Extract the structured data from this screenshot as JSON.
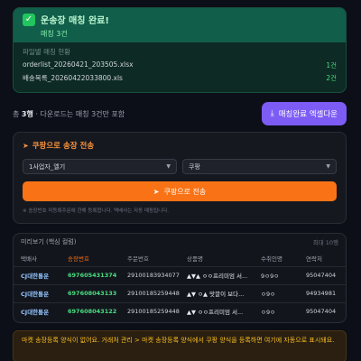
{
  "success": {
    "title": "운송장 매칭 완료!",
    "subtitle": "매칭 3건",
    "files_heading": "파일별 매칭 현황",
    "files": [
      {
        "name": "orderlist_20260421_203505.xlsx",
        "count": "1건"
      },
      {
        "name": "배송목록_20260422033800.xls",
        "count": "2건"
      }
    ]
  },
  "summary": {
    "prefix": "총",
    "total": "3행",
    "detail": "· 다운로드는 매칭 3건만 포함"
  },
  "actions": {
    "excel_download": "매칭완료 엑셀다운"
  },
  "coupang": {
    "title": "쿠팡으로 송장 전송",
    "vendor_select": "1사업자_엘기",
    "courier_select": "쿠팡",
    "send_button": "쿠팡으로 전송",
    "hint": "※ 송장번호 미등록주문에 한해 등록합니다. 택배사는 자동 매핑됩니다."
  },
  "preview": {
    "title": "미리보기 (핵심 컬럼)",
    "max_rows": "최대 10행",
    "columns": [
      "택배사",
      "송장번호",
      "주문번호",
      "상품명",
      "수취인명",
      "연락처"
    ],
    "rows": [
      [
        "CJ대한통운",
        "697605431374",
        "29100183934077",
        "▲▼▲ ㅇㅇ프리미엄 서...",
        "9ㅇ9ㅇ",
        "95047404"
      ],
      [
        "CJ대한통운",
        "697608043133",
        "29100185259448",
        "▲▼ ㅇ▲ 맛깔이 보다...",
        "ㅇ9ㅇ",
        "94934981"
      ],
      [
        "CJ대한통운",
        "697608043122",
        "29100185259448",
        "▲▼ ㅇㅇ프리미엄 서...",
        "ㅇ9ㅇ",
        "95047404"
      ]
    ]
  },
  "warning": {
    "text": "마켓 송장등록 양식이 없어요. 거래처 관리 > 마켓 송장등록 양식에서 쿠팡 양식을 등록하면 여기에 자동으로 표시돼요."
  }
}
